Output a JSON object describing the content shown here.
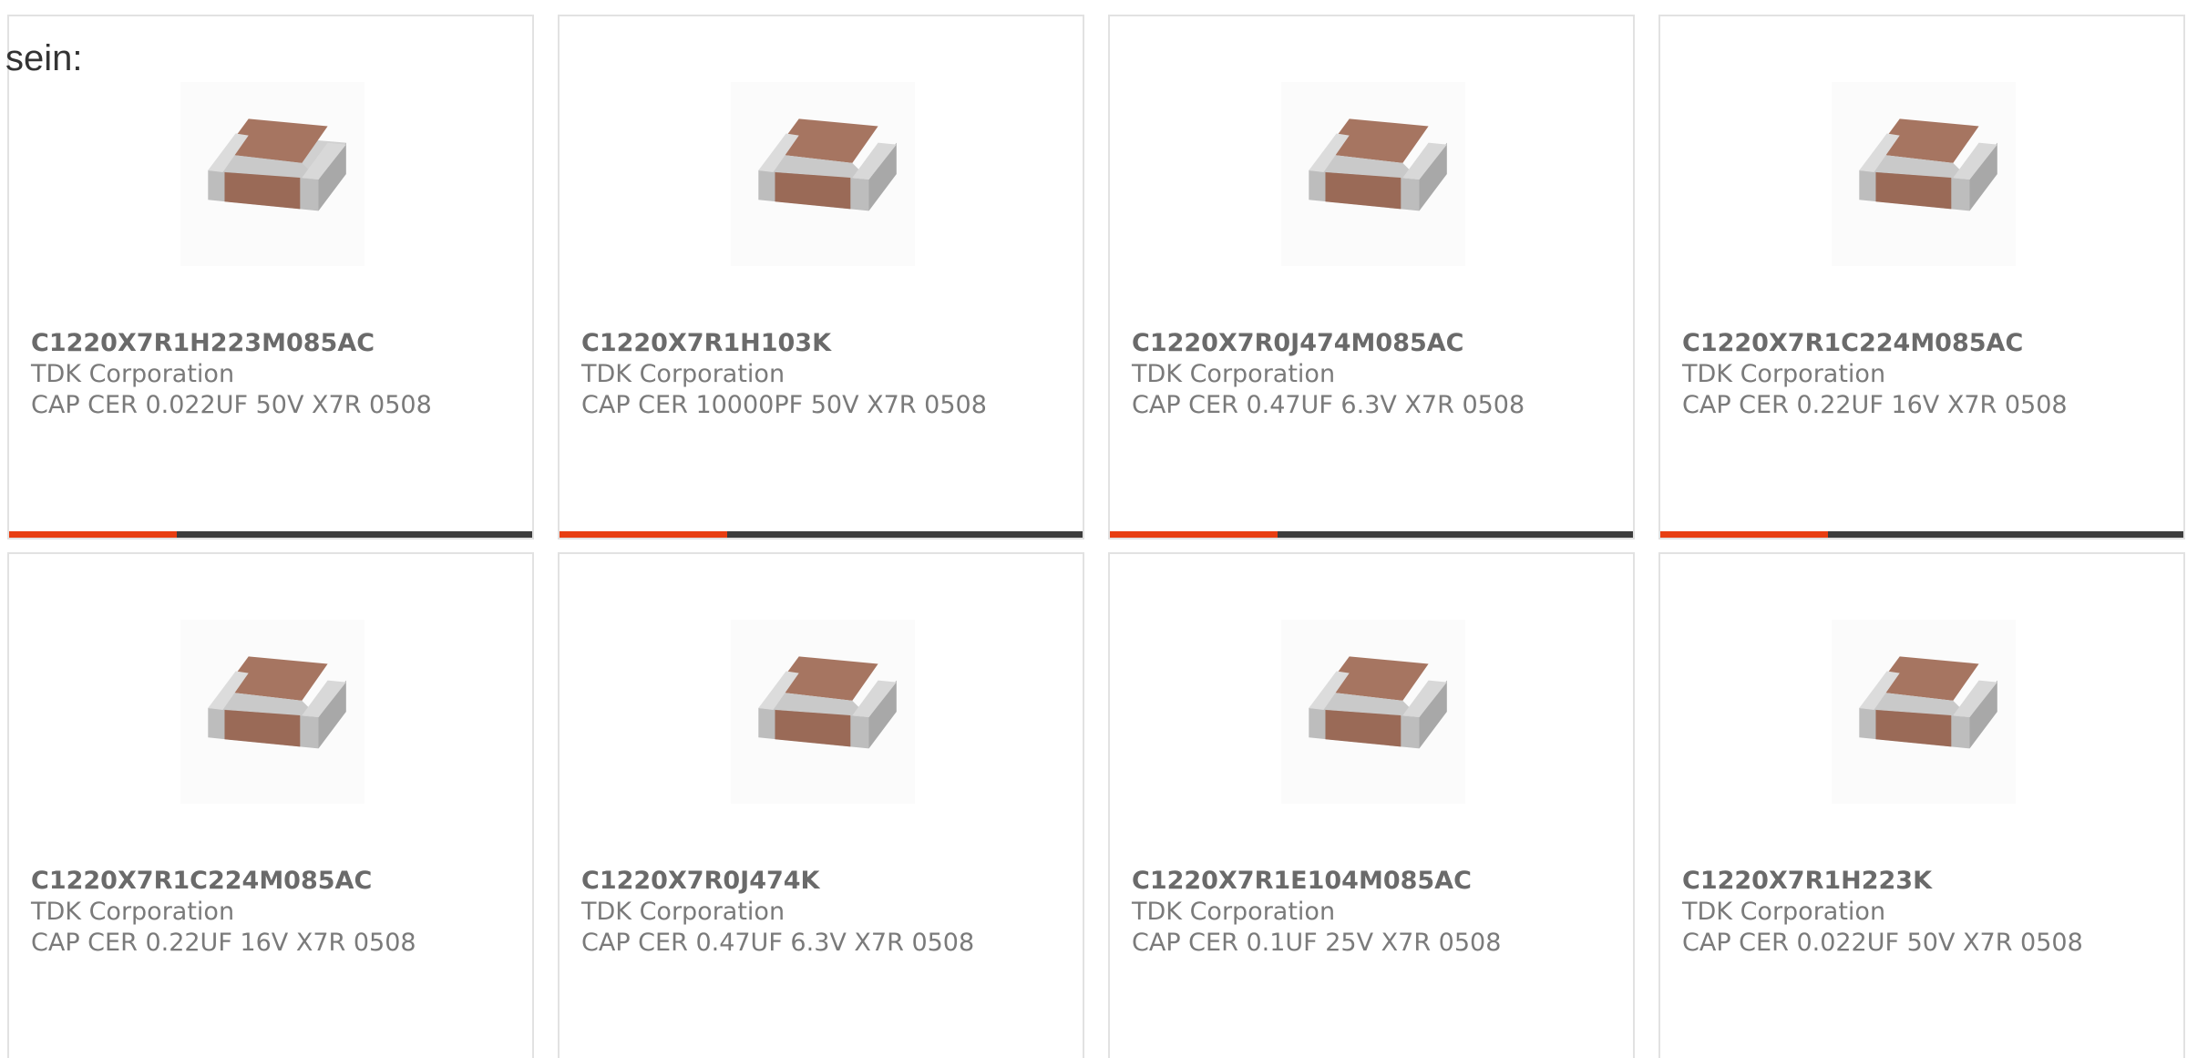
{
  "intro_text": "sein:",
  "colors": {
    "accent": "#e83e12",
    "bar_track": "#3d3d3d",
    "card_border": "#e2e2e2",
    "text": "#767676"
  },
  "products": [
    {
      "part_number": "C1220X7R1H223M085AC",
      "manufacturer": "TDK Corporation",
      "description": "CAP CER 0.022UF 50V X7R 0508",
      "image_icon": "ceramic-capacitor-chip",
      "progress": 0.32
    },
    {
      "part_number": "C1220X7R1H103K",
      "manufacturer": "TDK Corporation",
      "description": "CAP CER 10000PF 50V X7R 0508",
      "image_icon": "ceramic-capacitor-chip",
      "progress": 0.32
    },
    {
      "part_number": "C1220X7R0J474M085AC",
      "manufacturer": "TDK Corporation",
      "description": "CAP CER 0.47UF 6.3V X7R 0508",
      "image_icon": "ceramic-capacitor-chip",
      "progress": 0.32
    },
    {
      "part_number": "C1220X7R1C224M085AC",
      "manufacturer": "TDK Corporation",
      "description": "CAP CER 0.22UF 16V X7R 0508",
      "image_icon": "ceramic-capacitor-chip",
      "progress": 0.32
    },
    {
      "part_number": "C1220X7R1C224M085AC",
      "manufacturer": "TDK Corporation",
      "description": "CAP CER 0.22UF 16V X7R 0508",
      "image_icon": "ceramic-capacitor-chip",
      "progress": null
    },
    {
      "part_number": "C1220X7R0J474K",
      "manufacturer": "TDK Corporation",
      "description": "CAP CER 0.47UF 6.3V X7R 0508",
      "image_icon": "ceramic-capacitor-chip",
      "progress": null
    },
    {
      "part_number": "C1220X7R1E104M085AC",
      "manufacturer": "TDK Corporation",
      "description": "CAP CER 0.1UF 25V X7R 0508",
      "image_icon": "ceramic-capacitor-chip",
      "progress": null
    },
    {
      "part_number": "C1220X7R1H223K",
      "manufacturer": "TDK Corporation",
      "description": "CAP CER 0.022UF 50V X7R 0508",
      "image_icon": "ceramic-capacitor-chip",
      "progress": null
    }
  ]
}
